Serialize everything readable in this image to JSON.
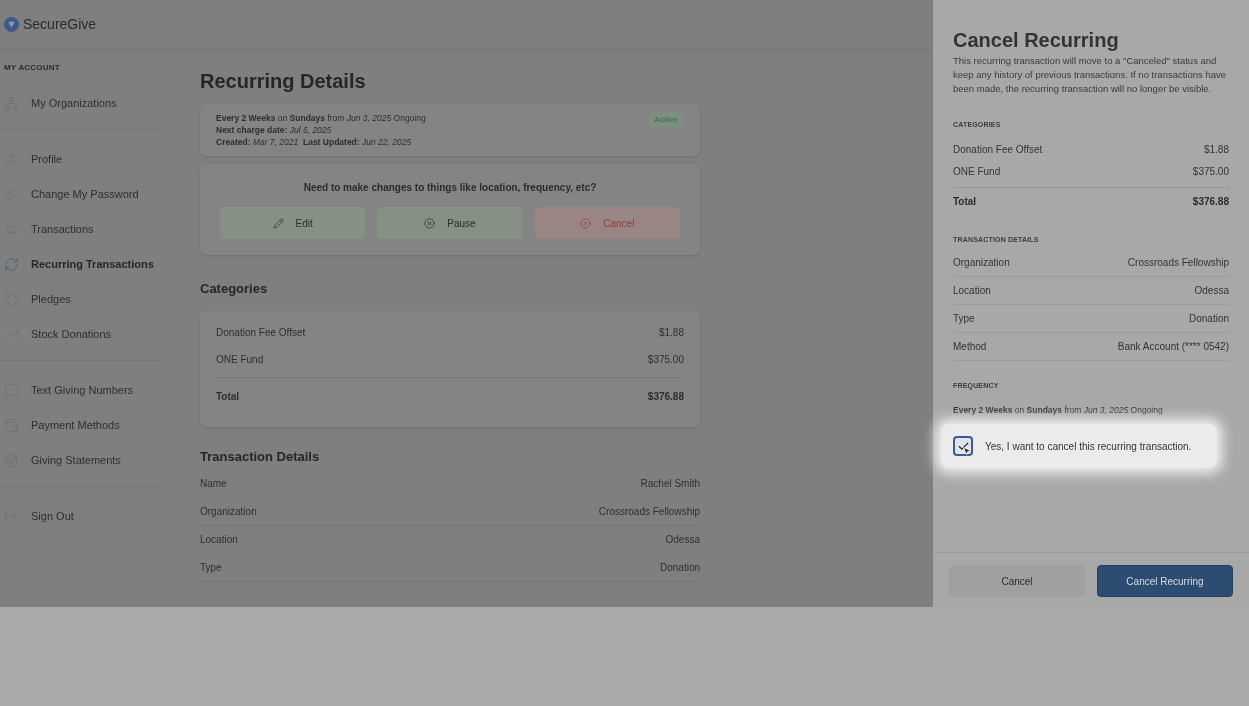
{
  "brand": {
    "name": "SecureGive"
  },
  "sidebar": {
    "heading": "MY ACCOUNT",
    "groups": [
      [
        {
          "label": "My Organizations",
          "selected": false
        }
      ],
      [
        {
          "label": "Profile",
          "selected": false
        },
        {
          "label": "Change My Password",
          "selected": false
        },
        {
          "label": "Transactions",
          "selected": false
        },
        {
          "label": "Recurring Transactions",
          "selected": true
        },
        {
          "label": "Pledges",
          "selected": false
        },
        {
          "label": "Stock Donations",
          "selected": false
        }
      ],
      [
        {
          "label": "Text Giving Numbers",
          "selected": false
        },
        {
          "label": "Payment Methods",
          "selected": false
        },
        {
          "label": "Giving Statements",
          "selected": false
        }
      ],
      [
        {
          "label": "Sign Out",
          "selected": false
        }
      ]
    ]
  },
  "page": {
    "title": "Recurring Details",
    "summary": {
      "lines": [
        "**Every 2 Weeks** on **Sundays** from *Jun 3, 2025* Ongoing",
        "**Next charge date:** *Jul 6, 2025*",
        "**Created:** *Mar 7, 2021*  **Last Updated:** *Jun 22, 2025*"
      ],
      "status": "Active"
    },
    "changes": {
      "prompt": "Need to make changes to things like location, frequency, etc?",
      "buttons": [
        {
          "label": "Edit",
          "kind": "edit"
        },
        {
          "label": "Pause",
          "kind": "pause"
        },
        {
          "label": "Cancel",
          "kind": "danger"
        }
      ]
    },
    "categories": {
      "title": "Categories",
      "rows": [
        {
          "name": "Donation Fee Offset",
          "amount": "$1.88"
        },
        {
          "name": "ONE Fund",
          "amount": "$375.00"
        }
      ],
      "total": {
        "name": "Total",
        "amount": "$376.88"
      }
    },
    "details": {
      "title": "Transaction Details",
      "rows": [
        {
          "label": "Name",
          "value": "Rachel Smith"
        },
        {
          "label": "Organization",
          "value": "Crossroads Fellowship"
        },
        {
          "label": "Location",
          "value": "Odessa"
        },
        {
          "label": "Type",
          "value": "Donation"
        }
      ]
    }
  },
  "drawer": {
    "title": "Cancel Recurring",
    "description": "This recurring transaction will move to a \"Canceled\" status and keep any history of previous transactions. If no transactions have been made, the recurring transaction will no longer be visible.",
    "categories": {
      "heading": "CATEGORIES",
      "rows": [
        {
          "name": "Donation Fee Offset",
          "amount": "$1.88"
        },
        {
          "name": "ONE Fund",
          "amount": "$375.00"
        }
      ],
      "total": {
        "name": "Total",
        "amount": "$376.88"
      }
    },
    "details": {
      "heading": "TRANSACTION DETAILS",
      "rows": [
        {
          "label": "Organization",
          "value": "Crossroads Fellowship"
        },
        {
          "label": "Location",
          "value": "Odessa"
        },
        {
          "label": "Type",
          "value": "Donation"
        },
        {
          "label": "Method",
          "value": "Bank Account (**** 0542)"
        }
      ]
    },
    "frequency": {
      "heading": "FREQUENCY",
      "text": "**Every 2 Weeks** on **Sundays** from *Jun 3, 2025* Ongoing"
    },
    "confirm": {
      "label": "Yes, I want to cancel this recurring transaction.",
      "checked": true
    },
    "buttons": [
      {
        "label": "Cancel",
        "kind": "secondary"
      },
      {
        "label": "Cancel Recurring",
        "kind": "primary"
      }
    ]
  }
}
